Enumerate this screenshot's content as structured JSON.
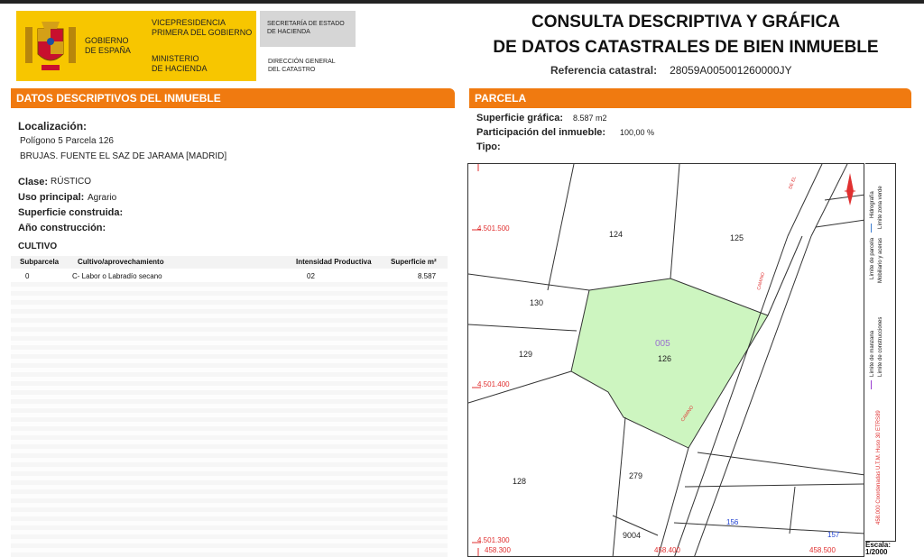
{
  "header": {
    "gobierno": "GOBIERNO\nDE ESPAÑA",
    "vicepresidencia": "VICEPRESIDENCIA\nPRIMERA DEL GOBIERNO",
    "ministerio": "MINISTERIO\nDE HACIENDA",
    "secretaria": "SECRETARÍA DE ESTADO\nDE HACIENDA",
    "direccion": "DIRECCIÓN GENERAL\nDEL CATASTRO",
    "title_line1": "CONSULTA DESCRIPTIVA Y GRÁFICA",
    "title_line2": "DE DATOS CATASTRALES DE BIEN INMUEBLE",
    "ref_label": "Referencia catastral:",
    "ref_value": "28059A005001260000JY"
  },
  "left": {
    "heading": "DATOS DESCRIPTIVOS DEL INMUEBLE",
    "localizacion_label": "Localización:",
    "localizacion_1": "Polígono 5 Parcela 126",
    "localizacion_2": "BRUJAS. FUENTE EL SAZ DE JARAMA [MADRID]",
    "clase_label": "Clase:",
    "clase_value": "RÚSTICO",
    "uso_label": "Uso principal:",
    "uso_value": "Agrario",
    "sup_label": "Superficie construida:",
    "anio_label": "Año construcción:",
    "cultivo_label": "CULTIVO",
    "table": {
      "headers": [
        "Subparcela",
        "Cultivo/aprovechamiento",
        "Intensidad Productiva",
        "Superficie m²"
      ],
      "rows": [
        [
          "0",
          "C- Labor o Labradío secano",
          "02",
          "8.587"
        ]
      ]
    }
  },
  "right": {
    "heading": "PARCELA",
    "sup_label": "Superficie gráfica:",
    "sup_value": "8.587 m2",
    "part_label": "Participación del inmueble:",
    "part_value": "100,00 %",
    "tipo_label": "Tipo:"
  },
  "map": {
    "parcel_fill": "#cdf5c0",
    "y_labels": [
      "4.501.500",
      "4.501.400",
      "4.501.300"
    ],
    "x_labels": [
      "458.300",
      "458.400",
      "458.500"
    ],
    "parcels": [
      "124",
      "125",
      "130",
      "129",
      "126",
      "128",
      "279",
      "9004",
      "156",
      "157"
    ],
    "subparcel": "005",
    "road_labels": [
      "DE EL",
      "CAMINO",
      "CAMINO"
    ],
    "legend": {
      "items": [
        "Límite de parcela",
        "Hidrografía",
        "Mobiliario y aceras",
        "Límite zona verde",
        "Límite de manzana",
        "Límite de construcciones"
      ],
      "coords": "458.000 Coordenadas U.T.M. Huso 30 ETRS89",
      "scale_label": "Escala:",
      "scale_value": "1/2000"
    }
  }
}
